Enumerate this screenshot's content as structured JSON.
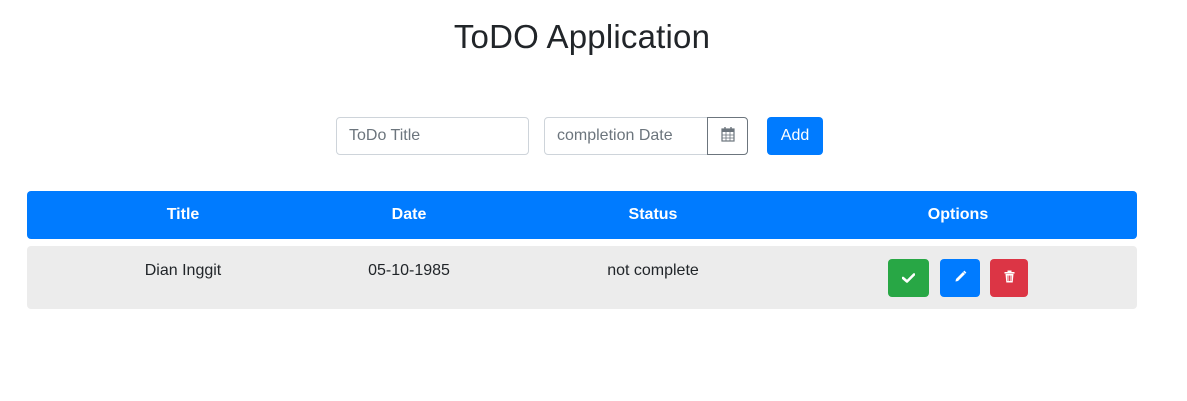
{
  "page": {
    "title": "ToDO Application"
  },
  "form": {
    "title_placeholder": "ToDo Title",
    "date_placeholder": "completion Date",
    "add_label": "Add",
    "calendar_icon": "calendar-icon"
  },
  "table": {
    "headers": {
      "title": "Title",
      "date": "Date",
      "status": "Status",
      "options": "Options"
    },
    "rows": [
      {
        "title": "Dian Inggit",
        "date": "05-10-1985",
        "status": "not complete",
        "actions": [
          "check-icon",
          "pencil-icon",
          "trash-icon"
        ]
      }
    ]
  },
  "colors": {
    "primary": "#007bff",
    "success": "#28a745",
    "danger": "#dc3545",
    "row_background": "#ececec"
  }
}
